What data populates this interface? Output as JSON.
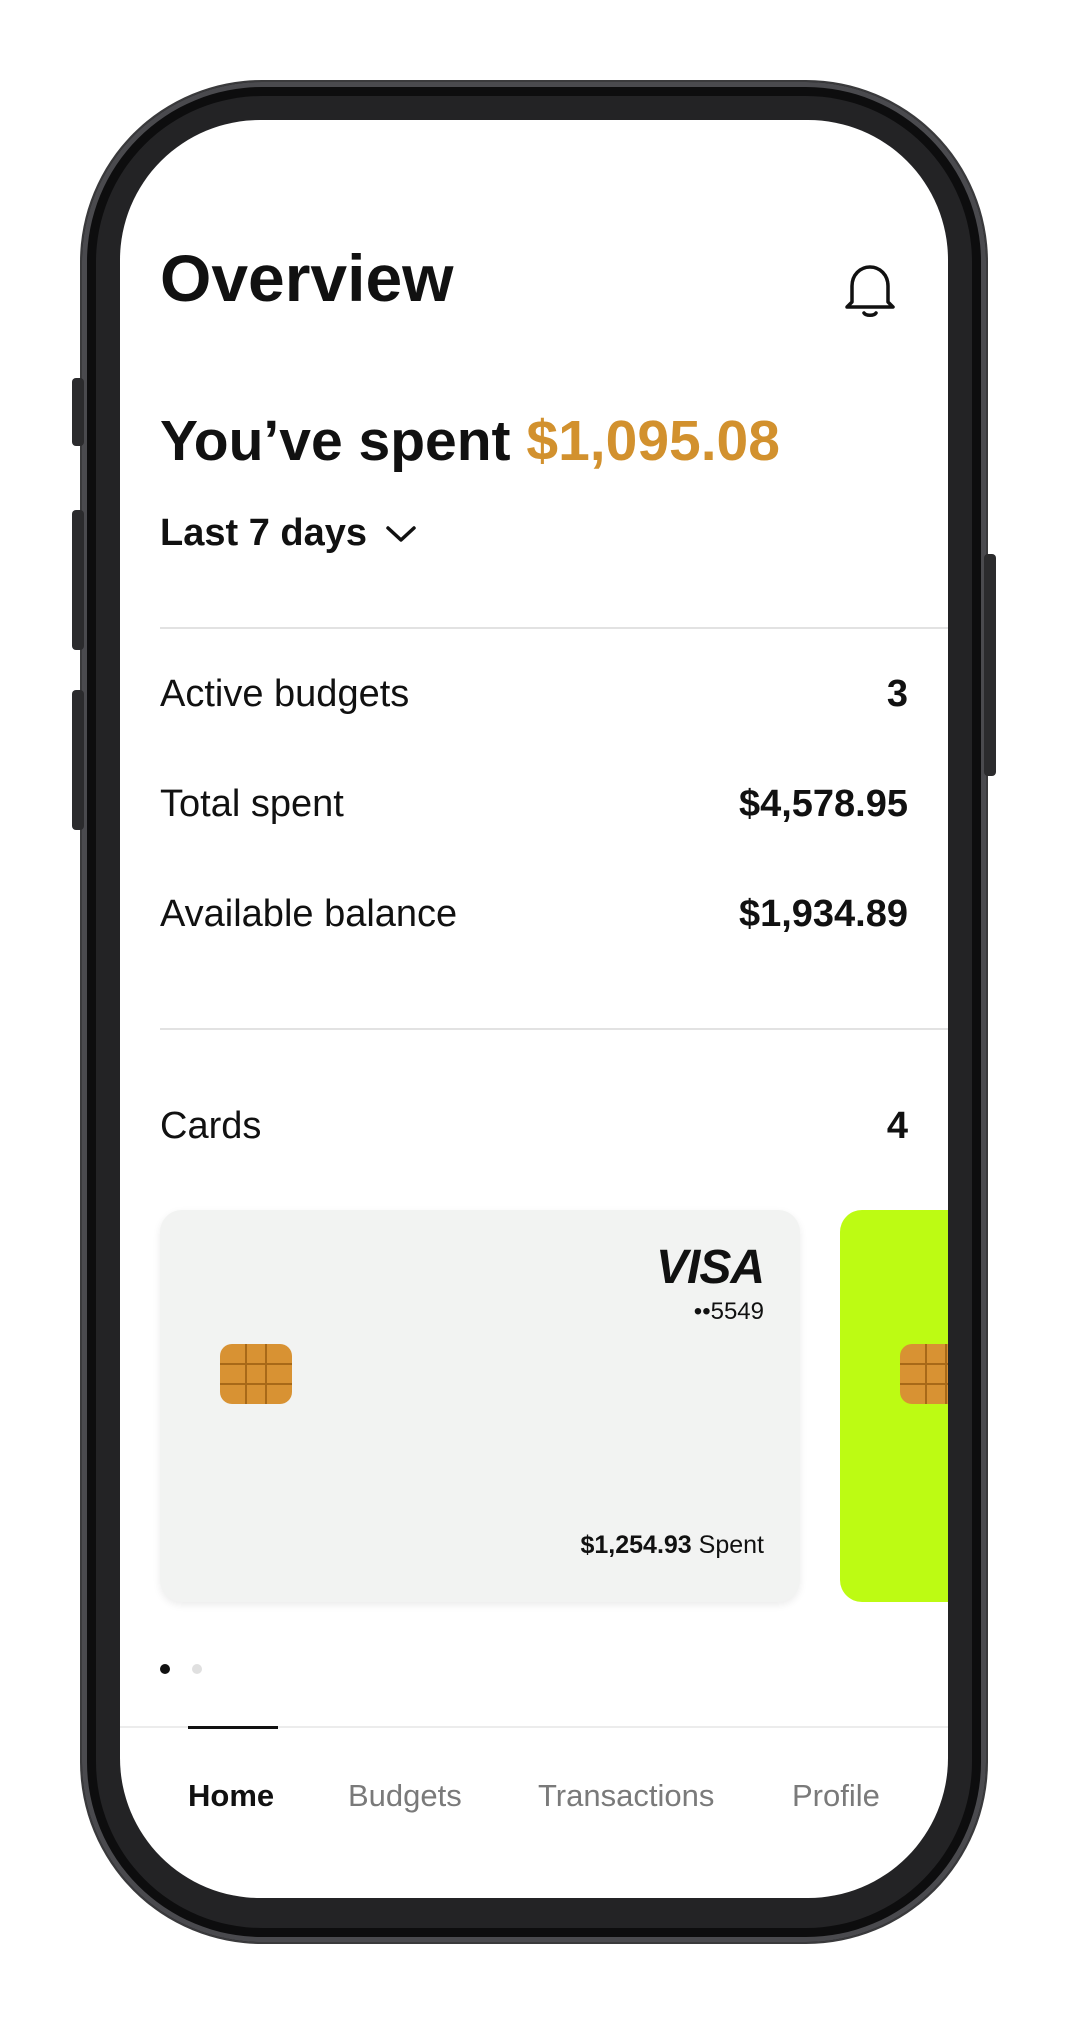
{
  "header": {
    "title": "Overview"
  },
  "summary": {
    "prefix": "You’ve spent",
    "amount": "$1,095.08",
    "range_label": "Last 7 days"
  },
  "stats": [
    {
      "label": "Active budgets",
      "value": "3"
    },
    {
      "label": "Total spent",
      "value": "$4,578.95"
    },
    {
      "label": "Available balance",
      "value": "$1,934.89"
    }
  ],
  "cards_section": {
    "label": "Cards",
    "count": "4"
  },
  "cards": [
    {
      "brand": "VISA",
      "last4": "••5549",
      "spent_amount": "$1,254.93",
      "spent_label": "Spent",
      "color": "#f2f3f2"
    },
    {
      "color": "#bdfb13"
    }
  ],
  "pagination": {
    "total": 2,
    "active": 0
  },
  "tabs": [
    {
      "label": "Home",
      "active": true
    },
    {
      "label": "Budgets",
      "active": false
    },
    {
      "label": "Transactions",
      "active": false
    },
    {
      "label": "Profile",
      "active": false
    }
  ],
  "colors": {
    "accent": "#d2912e",
    "card_green": "#bdfb13",
    "chip": "#d89233"
  },
  "icons": [
    "bell-icon",
    "chevron-down-icon",
    "chip-icon"
  ]
}
